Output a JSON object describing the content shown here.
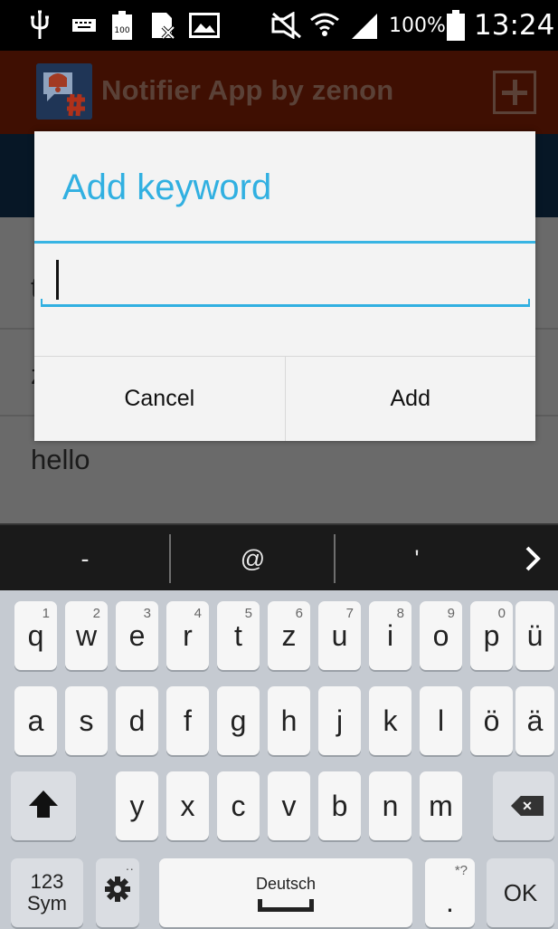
{
  "status_bar": {
    "battery_percent": "100%",
    "time": "13:24",
    "icons": [
      "usb-icon",
      "keyboard-icon",
      "battery-small-icon",
      "file-blocked-icon",
      "gallery-icon",
      "mute-icon",
      "wifi-icon",
      "signal-icon",
      "battery-icon"
    ]
  },
  "action_bar": {
    "title": "Notifier App by zenon",
    "add_icon": "plus-icon",
    "background": "#3f0f02"
  },
  "list": {
    "items": [
      "t",
      "z",
      "hello"
    ]
  },
  "dialog": {
    "title": "Add keyword",
    "input_value": "",
    "cancel_label": "Cancel",
    "add_label": "Add",
    "accent": "#31b0e1"
  },
  "suggestions": [
    "-",
    "@",
    "'"
  ],
  "keyboard": {
    "row1": [
      {
        "label": "q",
        "hint": "1"
      },
      {
        "label": "w",
        "hint": "2"
      },
      {
        "label": "e",
        "hint": "3"
      },
      {
        "label": "r",
        "hint": "4"
      },
      {
        "label": "t",
        "hint": "5"
      },
      {
        "label": "z",
        "hint": "6"
      },
      {
        "label": "u",
        "hint": "7"
      },
      {
        "label": "i",
        "hint": "8"
      },
      {
        "label": "o",
        "hint": "9"
      },
      {
        "label": "p",
        "hint": "0"
      },
      {
        "label": "ü",
        "hint": ""
      }
    ],
    "row2": [
      "a",
      "s",
      "d",
      "f",
      "g",
      "h",
      "j",
      "k",
      "l",
      "ö",
      "ä"
    ],
    "row3": [
      "y",
      "x",
      "c",
      "v",
      "b",
      "n",
      "m"
    ],
    "sym_label_top": "123",
    "sym_label_bottom": "Sym",
    "space_label": "Deutsch",
    "period_label": ".",
    "period_hint": "*?",
    "ok_label": "OK"
  }
}
